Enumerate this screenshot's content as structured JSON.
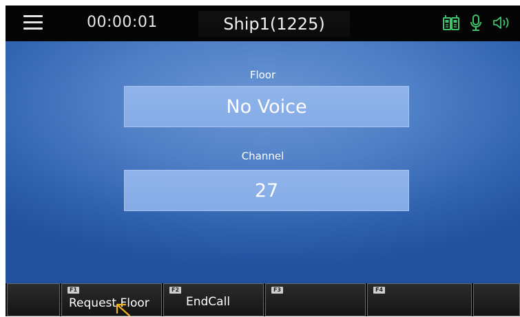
{
  "header": {
    "timer": "00:00:01",
    "title": "Ship1(1225)",
    "icons": [
      "menu-icon",
      "walkie-talkie-icon",
      "microphone-icon",
      "speaker-icon"
    ],
    "accent_color": "#3fc46a"
  },
  "floor": {
    "label": "Floor",
    "value": "No Voice"
  },
  "channel": {
    "label": "Channel",
    "value": "27"
  },
  "softkeys": [
    {
      "badge": "F1",
      "label": "Request Floor"
    },
    {
      "badge": "F2",
      "label": "EndCall"
    },
    {
      "badge": "F3",
      "label": ""
    },
    {
      "badge": "F4",
      "label": ""
    }
  ]
}
